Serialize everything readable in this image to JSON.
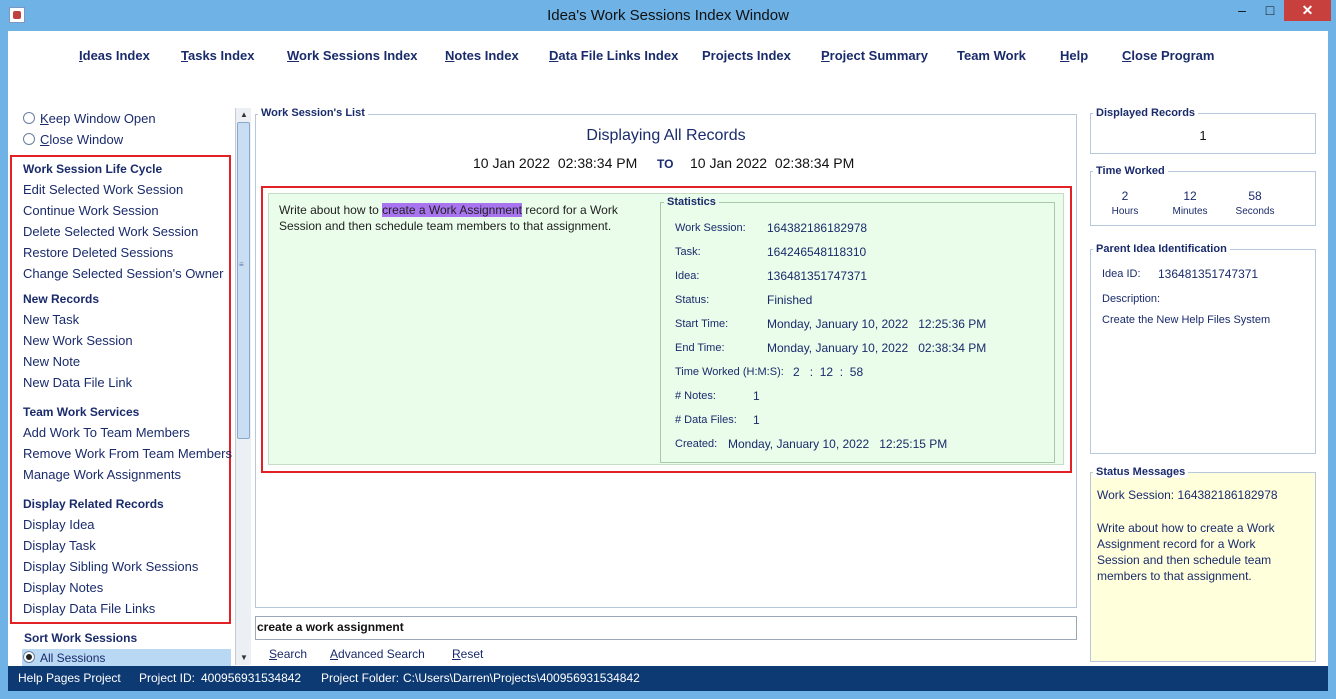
{
  "window": {
    "title": "Idea's Work Sessions Index Window",
    "minimize": "–",
    "maximize": "□",
    "close": "✕"
  },
  "menu": [
    {
      "u": "I",
      "rest": "deas Index"
    },
    {
      "u": "T",
      "rest": "asks Index"
    },
    {
      "u": "W",
      "rest": "ork Sessions Index"
    },
    {
      "u": "N",
      "rest": "otes Index"
    },
    {
      "u": "D",
      "rest": "ata File Links Index"
    },
    {
      "u": "",
      "rest": "Projects Index"
    },
    {
      "u": "P",
      "rest": "roject Summary"
    },
    {
      "u": "",
      "rest": "Team Work"
    },
    {
      "u": "H",
      "rest": "elp"
    },
    {
      "u": "C",
      "rest": "lose Program"
    }
  ],
  "sidebar": {
    "keep_open": {
      "u": "K",
      "rest": "eep Window Open"
    },
    "close_window": {
      "u": "C",
      "rest": "lose Window"
    },
    "sections": [
      {
        "title": "Work Session Life Cycle",
        "items": [
          "Edit Selected Work Session",
          "Continue Work Session",
          "Delete Selected Work Session",
          "Restore Deleted Sessions",
          "Change Selected Session's Owner"
        ]
      },
      {
        "title": "New Records",
        "items": [
          "New Task",
          "New Work Session",
          "New Note",
          "New Data File Link"
        ]
      },
      {
        "title": "Team Work Services",
        "items": [
          "Add Work To Team Members",
          "Remove Work From Team Members",
          "Manage Work Assignments"
        ]
      },
      {
        "title": "Display Related Records",
        "items": [
          "Display Idea",
          "Display Task",
          "Display Sibling Work Sessions",
          "Display Notes",
          "Display Data File Links"
        ]
      }
    ],
    "sort_title": "Sort Work Sessions",
    "sort_selected": "All Sessions"
  },
  "list": {
    "panel_title": "Work Session's List",
    "heading": "Displaying All Records",
    "from_date": "10 Jan 2022",
    "from_time": "02:38:34 PM",
    "to_label": "TO",
    "to_date": "10 Jan 2022",
    "to_time": "02:38:34 PM",
    "desc_before": "Write about how to ",
    "desc_highlight": "create a Work Assignment",
    "desc_after": " record for a Work",
    "desc_line2": "Session and then schedule team members to that assignment."
  },
  "statistics": {
    "title": "Statistics",
    "work_session_label": "Work Session:",
    "work_session": "164382186182978",
    "task_label": "Task:",
    "task": "164246548118310",
    "idea_label": "Idea:",
    "idea": "136481351747371",
    "status_label": "Status:",
    "status": "Finished",
    "start_label": "Start Time:",
    "start": "Monday, January 10, 2022",
    "start_time": "12:25:36 PM",
    "end_label": "End Time:",
    "end": "Monday, January 10, 2022",
    "end_time": "02:38:34 PM",
    "worked_label": "Time Worked (H:M:S):",
    "worked_h": "2",
    "worked_sep1": ":",
    "worked_m": "12",
    "worked_sep2": ":",
    "worked_s": "58",
    "notes_label": "# Notes:",
    "notes": "1",
    "files_label": "# Data Files:",
    "files": "1",
    "created_label": "Created:",
    "created": "Monday, January 10, 2022",
    "created_time": "12:25:15 PM"
  },
  "search": {
    "value": "create a work assignment",
    "search": {
      "u": "S",
      "rest": "earch"
    },
    "advanced": {
      "u": "A",
      "rest": "dvanced Search"
    },
    "reset": {
      "u": "R",
      "rest": "eset"
    }
  },
  "right": {
    "displayed_title": "Displayed Records",
    "displayed_value": "1",
    "worked_title": "Time Worked",
    "hours": "2",
    "hours_label": "Hours",
    "minutes": "12",
    "minutes_label": "Minutes",
    "seconds": "58",
    "seconds_label": "Seconds",
    "parent_title": "Parent Idea Identification",
    "idea_id_label": "Idea ID:",
    "idea_id": "136481351747371",
    "description_label": "Description:",
    "description": "Create the New Help Files System",
    "status_title": "Status Messages",
    "status_line1": "Work Session: 164382186182978",
    "status_msg": [
      "Write about how to create a Work",
      "Assignment record for a Work",
      "Session and then schedule team",
      "members to that assignment."
    ]
  },
  "statusbar": {
    "project": "Help Pages Project",
    "project_id_label": "Project ID:",
    "project_id": "400956931534842",
    "folder_label": "Project Folder:",
    "folder": "C:\\Users\\Darren\\Projects\\400956931534842"
  },
  "colors": {
    "title_bar": "#6eb2e6",
    "status_bar": "#0e3a73",
    "red_outline": "#e22025",
    "stats_bg": "#eafcea",
    "highlight": "#a874f0",
    "status_msg_bg": "#ffffdc",
    "close_button": "#c7403d"
  }
}
